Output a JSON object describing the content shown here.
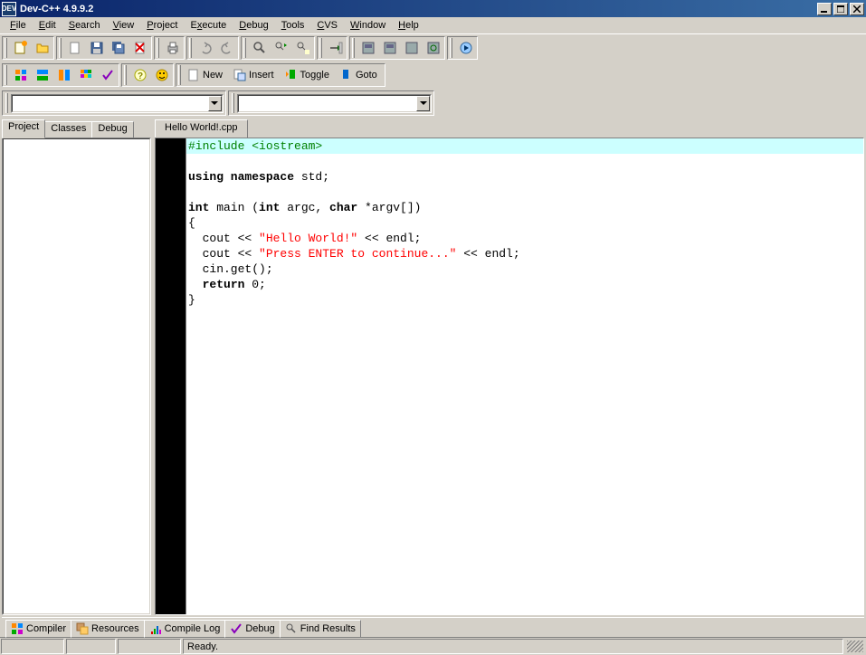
{
  "title": "Dev-C++ 4.9.9.2",
  "menu": {
    "file": "File",
    "edit": "Edit",
    "search": "Search",
    "view": "View",
    "project": "Project",
    "execute": "Execute",
    "debug": "Debug",
    "tools": "Tools",
    "cvs": "CVS",
    "window": "Window",
    "help": "Help"
  },
  "toolbar2": {
    "new": "New",
    "insert": "Insert",
    "toggle": "Toggle",
    "goto": "Goto"
  },
  "left_tabs": {
    "project": "Project",
    "classes": "Classes",
    "debug": "Debug"
  },
  "editor": {
    "tab": "Hello World!.cpp",
    "code": {
      "l1_pre": "#include <iostream>",
      "l3": "using namespace std;",
      "l5": "int main (int argc, char *argv[])",
      "l6": "{",
      "l7a": "  cout << ",
      "l7s": "\"Hello World!\"",
      "l7b": " << endl;",
      "l8a": "  cout << ",
      "l8s": "\"Press ENTER to continue...\"",
      "l8b": " << endl;",
      "l9": "  cin.get();",
      "l10a": "  ",
      "l10k": "return",
      "l10b": " 0;",
      "l11": "}"
    }
  },
  "bottom_tabs": {
    "compiler": "Compiler",
    "resources": "Resources",
    "compile_log": "Compile Log",
    "debug": "Debug",
    "find": "Find Results"
  },
  "status": {
    "ready": "Ready."
  }
}
